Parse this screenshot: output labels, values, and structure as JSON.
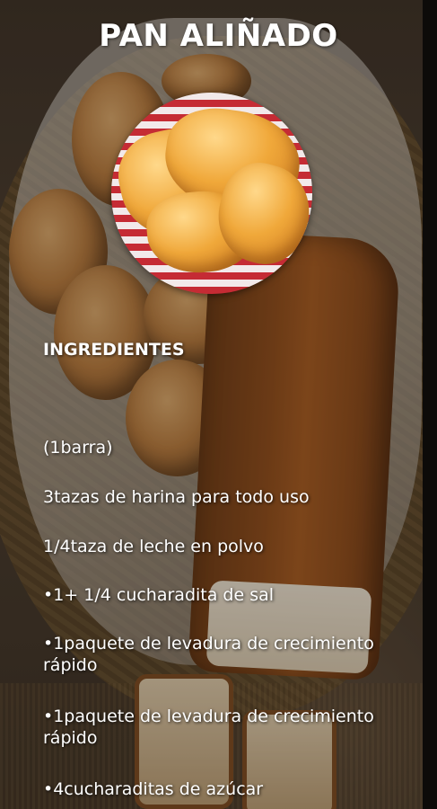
{
  "title": "PAN ALIÑADO",
  "ingredients_heading": "INGREDIENTES",
  "ingredients": [
    "(1barra)",
    "3tazas de harina para todo uso",
    "1/4taza de leche en polvo",
    "•1+ 1/4 cucharadita de sal",
    "•1paquete de levadura  de crecimiento rápido",
    "•1paquete  de levadura de crecimiento rápido",
    "•4cucharaditas de azúcar"
  ]
}
